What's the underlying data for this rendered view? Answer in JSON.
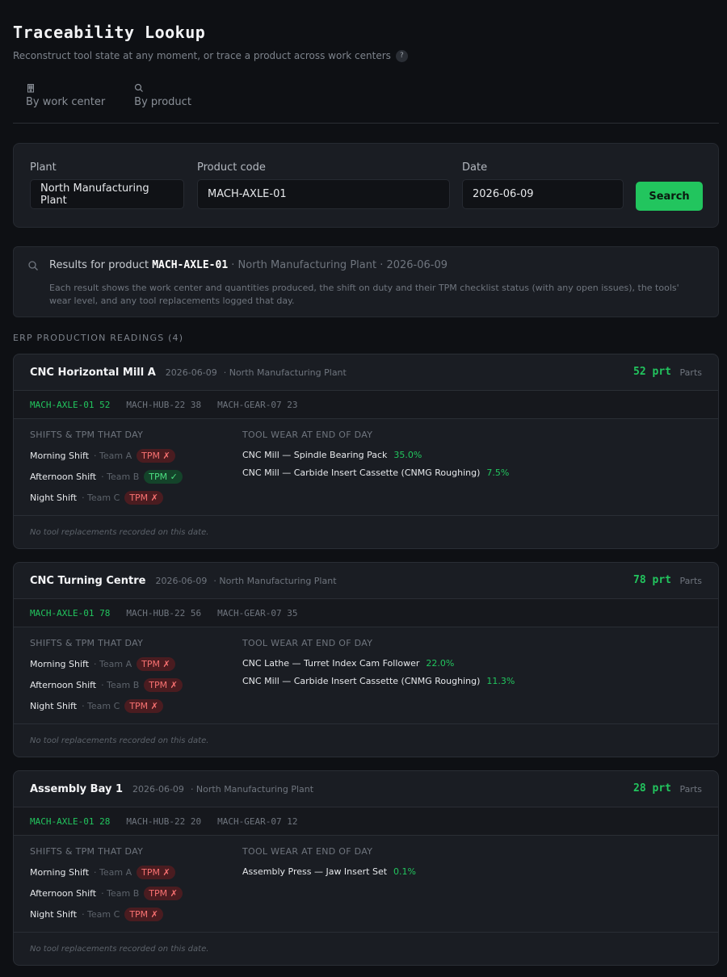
{
  "header": {
    "title": "Traceability Lookup",
    "subtitle": "Reconstruct tool state at any moment, or trace a product across work centers",
    "help_glyph": "?"
  },
  "tabs": [
    {
      "label": "By work center",
      "icon": "building-icon"
    },
    {
      "label": "By product",
      "icon": "search-icon"
    }
  ],
  "search": {
    "plant_label": "Plant",
    "plant_value": "North Manufacturing Plant",
    "product_label": "Product code",
    "product_value": "MACH-AXLE-01",
    "date_label": "Date",
    "date_value": "2026-06-09",
    "button_label": "Search"
  },
  "results": {
    "prefix": "Results for product",
    "code": "MACH-AXLE-01",
    "meta": "· North Manufacturing Plant · 2026-06-09",
    "description": "Each result shows the work center and quantities produced, the shift on duty and their TPM checklist status (with any open issues), the tools' wear level, and any tool replacements logged that day."
  },
  "section_label": "ERP PRODUCTION READINGS (4)",
  "labels": {
    "shifts_title": "SHIFTS & TPM THAT DAY",
    "wear_title": "TOOL WEAR AT END OF DAY",
    "qty_unit": "Parts",
    "no_replacements": "No tool replacements recorded on this date."
  },
  "cards": [
    {
      "name": "CNC Horizontal Mill A",
      "date": "2026-06-09",
      "plant": "· North Manufacturing Plant",
      "qty": "52 prt",
      "products": [
        {
          "code": "MACH-AXLE-01",
          "qty": "52"
        },
        {
          "code": "MACH-HUB-22",
          "qty": "38"
        },
        {
          "code": "MACH-GEAR-07",
          "qty": "23"
        }
      ],
      "shifts": [
        {
          "name": "Morning Shift",
          "team": "· Team A",
          "tpm": "TPM ✗",
          "ok": false
        },
        {
          "name": "Afternoon Shift",
          "team": "· Team B",
          "tpm": "TPM ✓",
          "ok": true
        },
        {
          "name": "Night Shift",
          "team": "· Team C",
          "tpm": "TPM ✗",
          "ok": false
        }
      ],
      "wear": [
        {
          "tool": "CNC Mill — Spindle Bearing Pack",
          "pct": "35.0%"
        },
        {
          "tool": "CNC Mill — Carbide Insert Cassette (CNMG Roughing)",
          "pct": "7.5%"
        }
      ]
    },
    {
      "name": "CNC Turning Centre",
      "date": "2026-06-09",
      "plant": "· North Manufacturing Plant",
      "qty": "78 prt",
      "products": [
        {
          "code": "MACH-AXLE-01",
          "qty": "78"
        },
        {
          "code": "MACH-HUB-22",
          "qty": "56"
        },
        {
          "code": "MACH-GEAR-07",
          "qty": "35"
        }
      ],
      "shifts": [
        {
          "name": "Morning Shift",
          "team": "· Team A",
          "tpm": "TPM ✗",
          "ok": false
        },
        {
          "name": "Afternoon Shift",
          "team": "· Team B",
          "tpm": "TPM ✗",
          "ok": false
        },
        {
          "name": "Night Shift",
          "team": "· Team C",
          "tpm": "TPM ✗",
          "ok": false
        }
      ],
      "wear": [
        {
          "tool": "CNC Lathe — Turret Index Cam Follower",
          "pct": "22.0%"
        },
        {
          "tool": "CNC Mill — Carbide Insert Cassette (CNMG Roughing)",
          "pct": "11.3%"
        }
      ]
    },
    {
      "name": "Assembly Bay 1",
      "date": "2026-06-09",
      "plant": "· North Manufacturing Plant",
      "qty": "28 prt",
      "products": [
        {
          "code": "MACH-AXLE-01",
          "qty": "28"
        },
        {
          "code": "MACH-HUB-22",
          "qty": "20"
        },
        {
          "code": "MACH-GEAR-07",
          "qty": "12"
        }
      ],
      "shifts": [
        {
          "name": "Morning Shift",
          "team": "· Team A",
          "tpm": "TPM ✗",
          "ok": false
        },
        {
          "name": "Afternoon Shift",
          "team": "· Team B",
          "tpm": "TPM ✗",
          "ok": false
        },
        {
          "name": "Night Shift",
          "team": "· Team C",
          "tpm": "TPM ✗",
          "ok": false
        }
      ],
      "wear": [
        {
          "tool": "Assembly Press — Jaw Insert Set",
          "pct": "0.1%"
        }
      ]
    }
  ]
}
